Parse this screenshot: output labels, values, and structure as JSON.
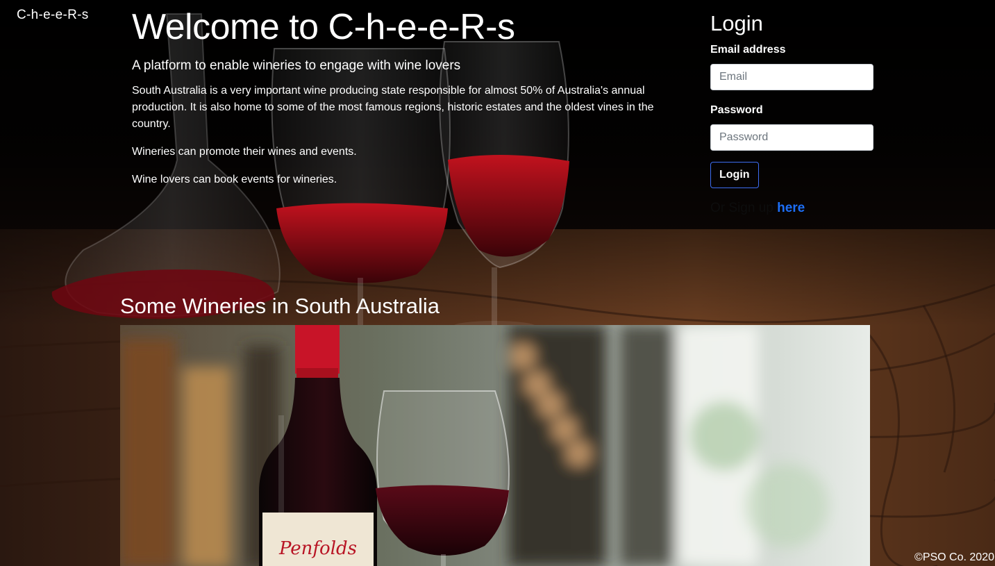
{
  "brand": {
    "name": "C-h-e-e-R-s"
  },
  "hero": {
    "title": "Welcome to C-h-e-e-R-s",
    "lead": "A platform to enable wineries to engage with wine lovers",
    "paragraphs": [
      "South Australia is a very important wine producing state responsible for almost 50% of Australia's annual production. It is also home to some of the most famous regions, historic estates and the oldest vines in the country.",
      "Wineries can promote their wines and events.",
      "Wine lovers can book events for wineries."
    ]
  },
  "login": {
    "title": "Login",
    "email_label": "Email address",
    "email_placeholder": "Email",
    "password_label": "Password",
    "password_placeholder": "Password",
    "button_label": "Login",
    "signup_prefix": "Or Sign up",
    "signup_link": "here"
  },
  "wineries": {
    "title": "Some Wineries in South Australia",
    "bottle_label": "Penfolds"
  },
  "footer": {
    "copyright": "©PSO Co. 2020"
  },
  "colors": {
    "link": "#1d6ef5",
    "button_border": "#3d6df2",
    "wine": "#8b0a14"
  }
}
